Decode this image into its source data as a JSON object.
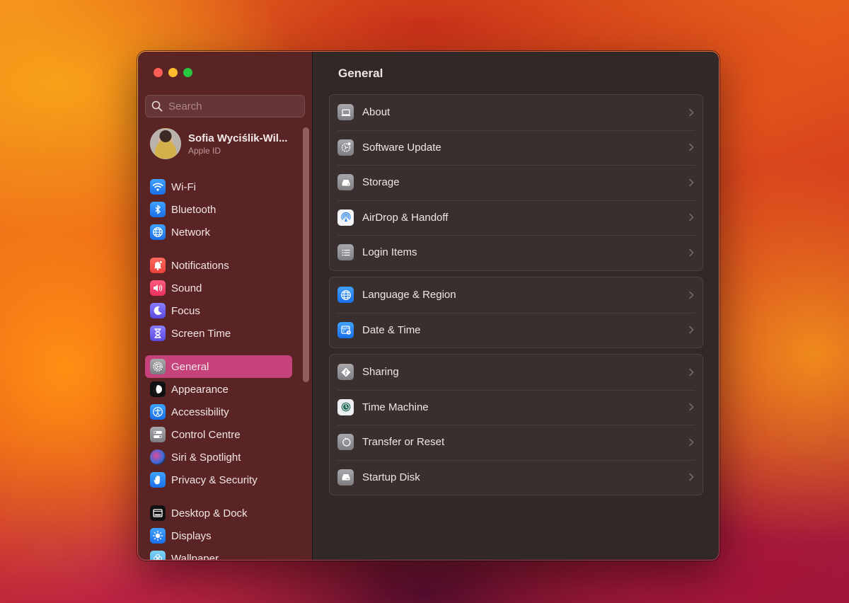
{
  "window": {
    "traffic_lights": [
      "close",
      "minimize",
      "zoom"
    ]
  },
  "sidebar": {
    "search": {
      "placeholder": "Search",
      "value": ""
    },
    "profile": {
      "name": "Sofia Wyciślik-Wil...",
      "subtitle": "Apple ID"
    },
    "groups": [
      [
        {
          "label": "Wi-Fi",
          "icon": "wifi-icon"
        },
        {
          "label": "Bluetooth",
          "icon": "bluetooth-icon"
        },
        {
          "label": "Network",
          "icon": "globe-icon"
        }
      ],
      [
        {
          "label": "Notifications",
          "icon": "bell-icon"
        },
        {
          "label": "Sound",
          "icon": "speaker-icon"
        },
        {
          "label": "Focus",
          "icon": "moon-icon"
        },
        {
          "label": "Screen Time",
          "icon": "hourglass-icon"
        }
      ],
      [
        {
          "label": "General",
          "icon": "gear-icon",
          "active": true
        },
        {
          "label": "Appearance",
          "icon": "appearance-icon"
        },
        {
          "label": "Accessibility",
          "icon": "accessibility-icon"
        },
        {
          "label": "Control Centre",
          "icon": "toggles-icon"
        },
        {
          "label": "Siri & Spotlight",
          "icon": "siri-icon"
        },
        {
          "label": "Privacy & Security",
          "icon": "hand-icon"
        }
      ],
      [
        {
          "label": "Desktop & Dock",
          "icon": "dock-icon"
        },
        {
          "label": "Displays",
          "icon": "sun-icon"
        },
        {
          "label": "Wallpaper",
          "icon": "flower-icon"
        }
      ]
    ]
  },
  "main": {
    "title": "General",
    "groups": [
      [
        {
          "label": "About",
          "icon": "laptop-icon"
        },
        {
          "label": "Software Update",
          "icon": "software-update-icon"
        },
        {
          "label": "Storage",
          "icon": "drive-icon"
        },
        {
          "label": "AirDrop & Handoff",
          "icon": "airdrop-icon"
        },
        {
          "label": "Login Items",
          "icon": "list-icon"
        }
      ],
      [
        {
          "label": "Language & Region",
          "icon": "globe-icon"
        },
        {
          "label": "Date & Time",
          "icon": "calendar-clock-icon"
        }
      ],
      [
        {
          "label": "Sharing",
          "icon": "sharing-icon"
        },
        {
          "label": "Time Machine",
          "icon": "time-machine-icon"
        },
        {
          "label": "Transfer or Reset",
          "icon": "reset-icon"
        },
        {
          "label": "Startup Disk",
          "icon": "disk-icon"
        }
      ]
    ]
  },
  "colors": {
    "sidebar_bg": "#5a2424",
    "content_bg": "#332828",
    "selection": "#c6427a"
  }
}
